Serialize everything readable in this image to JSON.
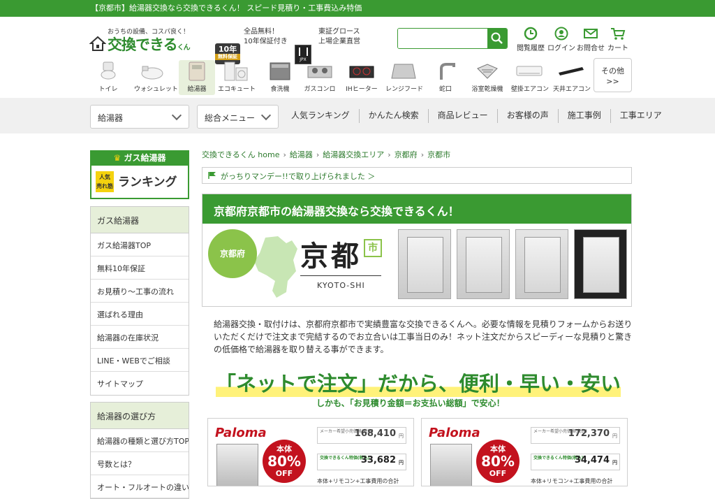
{
  "topbar": {
    "text": "【京都市】給湯器交換なら交換できるくん！ スピード見積り・工事費込み特価"
  },
  "logo": {
    "tagline": "おうちの設備、コスパ良く！",
    "name": "交換できる",
    "suffix": "くん"
  },
  "badges": {
    "warranty_top": "10年",
    "warranty_bottom": "無料保証",
    "free_line1": "全品無料！",
    "free_line2": "10年保証付き",
    "jpx": "JPX",
    "listed_line1": "東証グロース",
    "listed_line2": "上場企業直営"
  },
  "search": {
    "placeholder": ""
  },
  "utility": [
    {
      "label": "閲覧履歴"
    },
    {
      "label": "ログイン"
    },
    {
      "label": "お問合せ"
    },
    {
      "label": "カート"
    }
  ],
  "categories": [
    {
      "label": "トイレ"
    },
    {
      "label": "ウォシュレット"
    },
    {
      "label": "給湯器"
    },
    {
      "label": "エコキュート"
    },
    {
      "label": "食洗機"
    },
    {
      "label": "ガスコンロ"
    },
    {
      "label": "IHヒーター"
    },
    {
      "label": "レンジフード"
    },
    {
      "label": "蛇口"
    },
    {
      "label": "浴室乾燥機"
    },
    {
      "label": "壁掛エアコン"
    },
    {
      "label": "天井エアコン"
    }
  ],
  "more": {
    "line1": "その他",
    "line2": ">>"
  },
  "nav": {
    "select1": "給湯器",
    "select2": "総合メニュー",
    "links": [
      "人気ランキング",
      "かんたん検索",
      "商品レビュー",
      "お客様の声",
      "施工事例",
      "工事エリア"
    ]
  },
  "ranking": {
    "title": "ガス給湯器",
    "badge_line1": "人気",
    "badge_line2": "売れ筋",
    "big": "ランキング"
  },
  "sidebar": {
    "box1": {
      "header": "ガス給湯器",
      "items": [
        "ガス給湯器TOP",
        "無料10年保証",
        "お見積り～工事の流れ",
        "選ばれる理由",
        "給湯器の在庫状況",
        "LINE・WEBでご相談",
        "サイトマップ"
      ]
    },
    "box2": {
      "header": "給湯器の選び方",
      "items": [
        "給湯器の種類と選び方TOP",
        "号数とは？",
        "オート・フルオートの違い"
      ]
    }
  },
  "breadcrumb": [
    "交換できるくん home",
    "給湯器",
    "給湯器交換エリア",
    "京都府",
    "京都市"
  ],
  "mandy": {
    "text": "がっちりマンデー!!で取り上げられました ＞"
  },
  "hero": {
    "title": "京都府京都市の給湯器交換なら交換できるくん！",
    "pref": "京都府",
    "city": "京都",
    "shi": "市",
    "roman": "KYOTO-SHI"
  },
  "description": "給湯器交換・取付けは、京都府京都市で実績豊富な交換できるくんへ。必要な情報を見積りフォームからお送りいただくだけで注文まで完結するのでお立合いは工事当日のみ！ネット注文だからスピーディーな見積りと驚きの低価格で給湯器を取り替える事ができます。",
  "slogan": "「ネットで注文」だから、便利・早い・安い",
  "subslogan": "しかも、「お見積り金額＝お支払い総額」で安心！",
  "products": [
    {
      "brand": "Paloma",
      "off_label": "本体",
      "off_value": "80%",
      "off_word": "OFF",
      "maker_label": "メーカー希望小売価格(税込)",
      "maker_price": "168,410",
      "our_label": "交換できるくん特価(税込)",
      "our_price": "33,682",
      "yen": "円",
      "bottom": "本体+リモコン+工事費用の合計"
    },
    {
      "brand": "Paloma",
      "off_label": "本体",
      "off_value": "80%",
      "off_word": "OFF",
      "maker_label": "メーカー希望小売価格(税込)",
      "maker_price": "172,370",
      "our_label": "交換できるくん特価(税込)",
      "our_price": "34,474",
      "yen": "円",
      "bottom": "本体+リモコン+工事費用の合計"
    }
  ],
  "colors": {
    "brand_green": "#3a9a32",
    "accent_red": "#c3121e",
    "highlight": "#fff27a"
  }
}
